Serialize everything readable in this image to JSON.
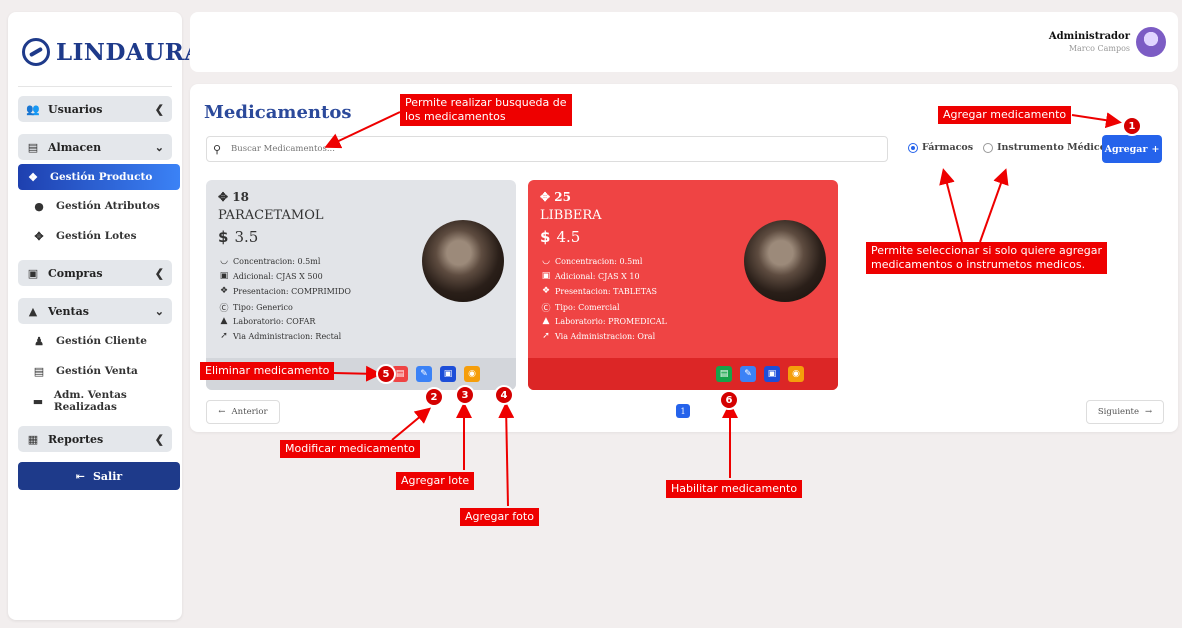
{
  "brand": {
    "name": "LINDAURA"
  },
  "sidebar": {
    "groups": [
      {
        "label": "Usuarios",
        "icon": "users-icon",
        "chevron": "<"
      },
      {
        "label": "Almacen",
        "icon": "warehouse-icon",
        "chevron": "v"
      },
      {
        "label": "Compras",
        "icon": "cart-icon",
        "chevron": "<"
      },
      {
        "label": "Ventas",
        "icon": "sales-icon",
        "chevron": "v"
      },
      {
        "label": "Reportes",
        "icon": "report-icon",
        "chevron": "<"
      }
    ],
    "almacen_items": [
      "Gestión Producto",
      "Gestión Atributos",
      "Gestión Lotes"
    ],
    "ventas_items": [
      "Gestión Cliente",
      "Gestión Venta",
      "Adm. Ventas Realizadas"
    ],
    "active_item": "Gestión Producto",
    "logout_label": "Salir"
  },
  "header": {
    "user_role": "Administrador",
    "user_name": "Marco Campos"
  },
  "main": {
    "title": "Medicamentos",
    "search_placeholder": "Buscar Medicamentos...",
    "filter_options": [
      "Fármacos",
      "Instrumento Médicos"
    ],
    "filter_selected": "Fármacos",
    "add_label": "Agregar",
    "prev_label": "Anterior",
    "next_label": "Siguiente",
    "current_page": "1"
  },
  "products": [
    {
      "stock": "18",
      "name": "PARACETAMOL",
      "price": "3.5",
      "concentracion": "Concentracion: 0.5ml",
      "adicional": "Adicional: CJAS X 500",
      "presentacion": "Presentacion: COMPRIMIDO",
      "tipo": "Tipo: Generico",
      "laboratorio": "Laboratorio: COFAR",
      "via": "Via Administracion: Rectal",
      "status": "enabled",
      "color": "#e2e4e8"
    },
    {
      "stock": "25",
      "name": "LIBBERA",
      "price": "4.5",
      "concentracion": "Concentracion: 0.5ml",
      "adicional": "Adicional: CJAS X 10",
      "presentacion": "Presentacion: TABLETAS",
      "tipo": "Tipo: Comercial",
      "laboratorio": "Laboratorio: PROMEDICAL",
      "via": "Via Administracion: Oral",
      "status": "disabled",
      "color": "#ef4444"
    }
  ],
  "annotations": {
    "search": "Permite realizar busqueda de los medicamentos",
    "search_l1": "Permite realizar busqueda de",
    "search_l2": "los medicamentos",
    "add": "Agregar medicamento",
    "filter_l1": "Permite seleccionar si solo quiere agregar",
    "filter_l2": "medicamentos o instrumetos medicos.",
    "delete": "Eliminar medicamento",
    "edit": "Modificar medicamento",
    "lote": "Agregar lote",
    "foto": "Agregar foto",
    "enable": "Habilitar medicamento",
    "n1": "1",
    "n2": "2",
    "n3": "3",
    "n4": "4",
    "n5": "5",
    "n6": "6"
  }
}
